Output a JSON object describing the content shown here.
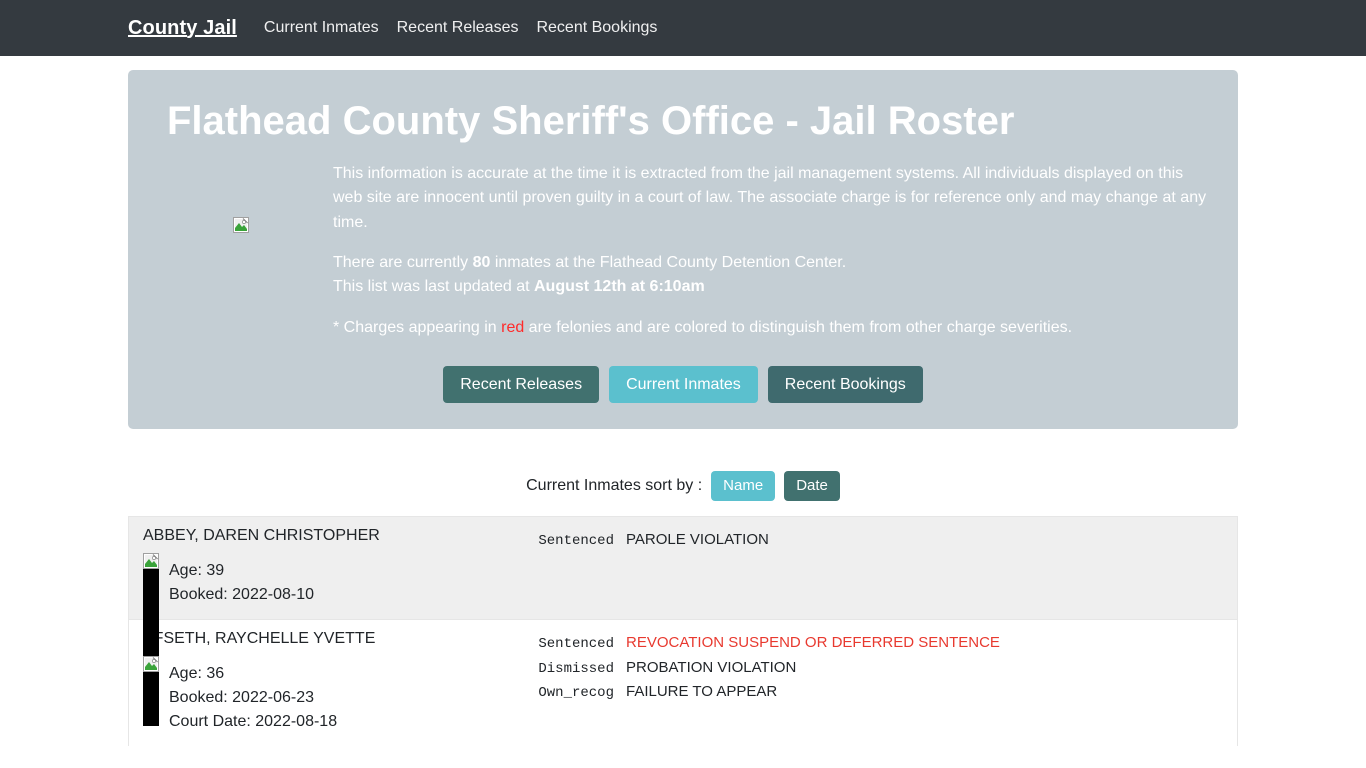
{
  "navbar": {
    "brand": "County Jail",
    "links": [
      {
        "label": "Current Inmates"
      },
      {
        "label": "Recent Releases"
      },
      {
        "label": "Recent Bookings"
      }
    ]
  },
  "hero": {
    "title": "Flathead County Sheriff's Office - Jail Roster",
    "image_alt": "",
    "disclaimer": "This information is accurate at the time it is extracted from the jail management systems. All individuals displayed on this web site are innocent until proven guilty in a court of law. The associate charge is for reference only and may change at any time.",
    "count_prefix": "There are currently ",
    "count_value": "80",
    "count_suffix": " inmates at the Flathead County Detention Center.",
    "updated_prefix": "This list was last updated at ",
    "updated_value": "August 12th at 6:10am",
    "felony_note_before": "* Charges appearing in ",
    "felony_note_word": "red",
    "felony_note_after": " are felonies and are colored to distinguish them from other charge severities.",
    "buttons": [
      {
        "label": "Recent Releases",
        "style": "dark"
      },
      {
        "label": "Current Inmates",
        "style": "light"
      },
      {
        "label": "Recent Bookings",
        "style": "dark2"
      }
    ]
  },
  "sortbar": {
    "label": "Current Inmates sort by :",
    "buttons": [
      {
        "label": "Name",
        "style": "light"
      },
      {
        "label": "Date",
        "style": "dark"
      }
    ]
  },
  "colors": {
    "navbar_bg": "#343a40",
    "hero_bg": "#c4ced4",
    "row_odd_bg": "#efefef",
    "row_even_bg": "#ffffff",
    "teal_dark": "#41716f",
    "teal_light": "#5bc0ce",
    "felony_red": "#e8392f",
    "hero_red": "#ff2a2a"
  },
  "inmates": [
    {
      "name": "ABBEY, DAREN CHRISTOPHER",
      "age_label": "Age: 39",
      "booked_label": "Booked: 2022-08-10",
      "court_label": "",
      "charges": [
        {
          "status": "Sentenced",
          "description": "PAROLE VIOLATION",
          "felony": false
        }
      ]
    },
    {
      "name": "AFSETH, RAYCHELLE YVETTE",
      "age_label": "Age: 36",
      "booked_label": "Booked: 2022-06-23",
      "court_label": "Court Date: 2022-08-18",
      "charges": [
        {
          "status": "Sentenced",
          "description": "REVOCATION SUSPEND OR DEFERRED SENTENCE",
          "felony": true
        },
        {
          "status": "Dismissed",
          "description": "PROBATION VIOLATION",
          "felony": false
        },
        {
          "status": "Own_recog",
          "description": "FAILURE TO APPEAR",
          "felony": false
        }
      ]
    }
  ]
}
